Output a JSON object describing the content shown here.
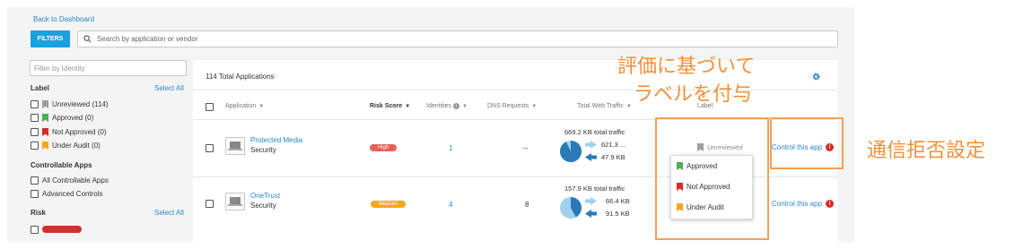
{
  "header": {
    "back_link": "Back to Dashboard",
    "filters_label": "FILTERS",
    "search_placeholder": "Search by application or vendor"
  },
  "sidebar": {
    "identity_placeholder": "Filter by Identity",
    "label_section": {
      "title": "Label",
      "select_all": "Select All",
      "items": [
        {
          "label": "Unreviewed (114)",
          "color": "#9e9e9e"
        },
        {
          "label": "Approved (0)",
          "color": "#4caf50"
        },
        {
          "label": "Not Approved (0)",
          "color": "#d32f2f"
        },
        {
          "label": "Under Audit (0)",
          "color": "#f5a623"
        }
      ]
    },
    "controllable_section": {
      "title": "Controllable Apps",
      "items": [
        {
          "label": "All Controllable Apps"
        },
        {
          "label": "Advanced Controls"
        }
      ]
    },
    "risk_section": {
      "title": "Risk",
      "select_all": "Select All"
    }
  },
  "table": {
    "total_label": "114 Total Applications",
    "columns": {
      "application": "Application",
      "risk_score": "Risk Score",
      "identities": "Identities",
      "dns_requests": "DNS Requests",
      "total_web_traffic": "Total Web Traffic",
      "label": "Label"
    },
    "rows": [
      {
        "name": "Protected Media",
        "category": "Security",
        "risk": "High",
        "risk_color": "#e8605a",
        "identities": "1",
        "dns": "--",
        "traffic_total": "669.2 KB total traffic",
        "upload": "621.3 ...",
        "download": "47.9 KB",
        "label": "Unreviewed",
        "control": "Control this app",
        "pie_fraction": 0.93
      },
      {
        "name": "OneTrust",
        "category": "Security",
        "risk": "Medium",
        "risk_color": "#f5a623",
        "identities": "4",
        "dns": "8",
        "traffic_total": "157.9 KB total traffic",
        "upload": "66.4 KB",
        "download": "91.5 KB",
        "control": "Control this app",
        "pie_fraction": 0.42
      }
    ]
  },
  "label_dropdown": {
    "items": [
      {
        "label": "Approved",
        "color": "#4caf50"
      },
      {
        "label": "Not Approved",
        "color": "#d32f2f"
      },
      {
        "label": "Under Audit",
        "color": "#f5a623"
      }
    ]
  },
  "annotations": {
    "label_note_line1": "評価に基づいて",
    "label_note_line2": "ラベルを付与",
    "control_note": "通信拒否設定"
  }
}
